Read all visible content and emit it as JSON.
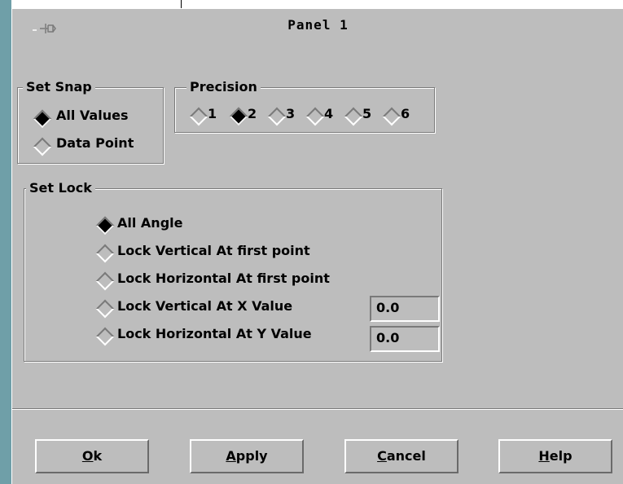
{
  "window": {
    "title": "Panel 1"
  },
  "snap": {
    "legend": "Set Snap",
    "options": [
      {
        "label": "All Values",
        "selected": true
      },
      {
        "label": "Data Point",
        "selected": false
      }
    ]
  },
  "precision": {
    "legend": "Precision",
    "options": [
      {
        "label": "1",
        "selected": false
      },
      {
        "label": "2",
        "selected": true
      },
      {
        "label": "3",
        "selected": false
      },
      {
        "label": "4",
        "selected": false
      },
      {
        "label": "5",
        "selected": false
      },
      {
        "label": "6",
        "selected": false
      }
    ]
  },
  "lock": {
    "legend": "Set Lock",
    "options": [
      {
        "label": "All Angle",
        "selected": true
      },
      {
        "label": "Lock Vertical At first point",
        "selected": false
      },
      {
        "label": "Lock Horizontal At first point",
        "selected": false
      },
      {
        "label": "Lock Vertical At X Value",
        "selected": false
      },
      {
        "label": "Lock Horizontal At Y Value",
        "selected": false
      }
    ],
    "x_value": "0.0",
    "y_value": "0.0"
  },
  "buttons": {
    "ok": {
      "mnemonic": "O",
      "rest": "k"
    },
    "apply": {
      "mnemonic": "A",
      "rest": "pply"
    },
    "cancel": {
      "mnemonic": "C",
      "rest": "ancel"
    },
    "help": {
      "mnemonic": "H",
      "rest": "elp"
    }
  },
  "icons": {
    "window_menu": "pin-icon",
    "radio": "diamond-radio"
  }
}
